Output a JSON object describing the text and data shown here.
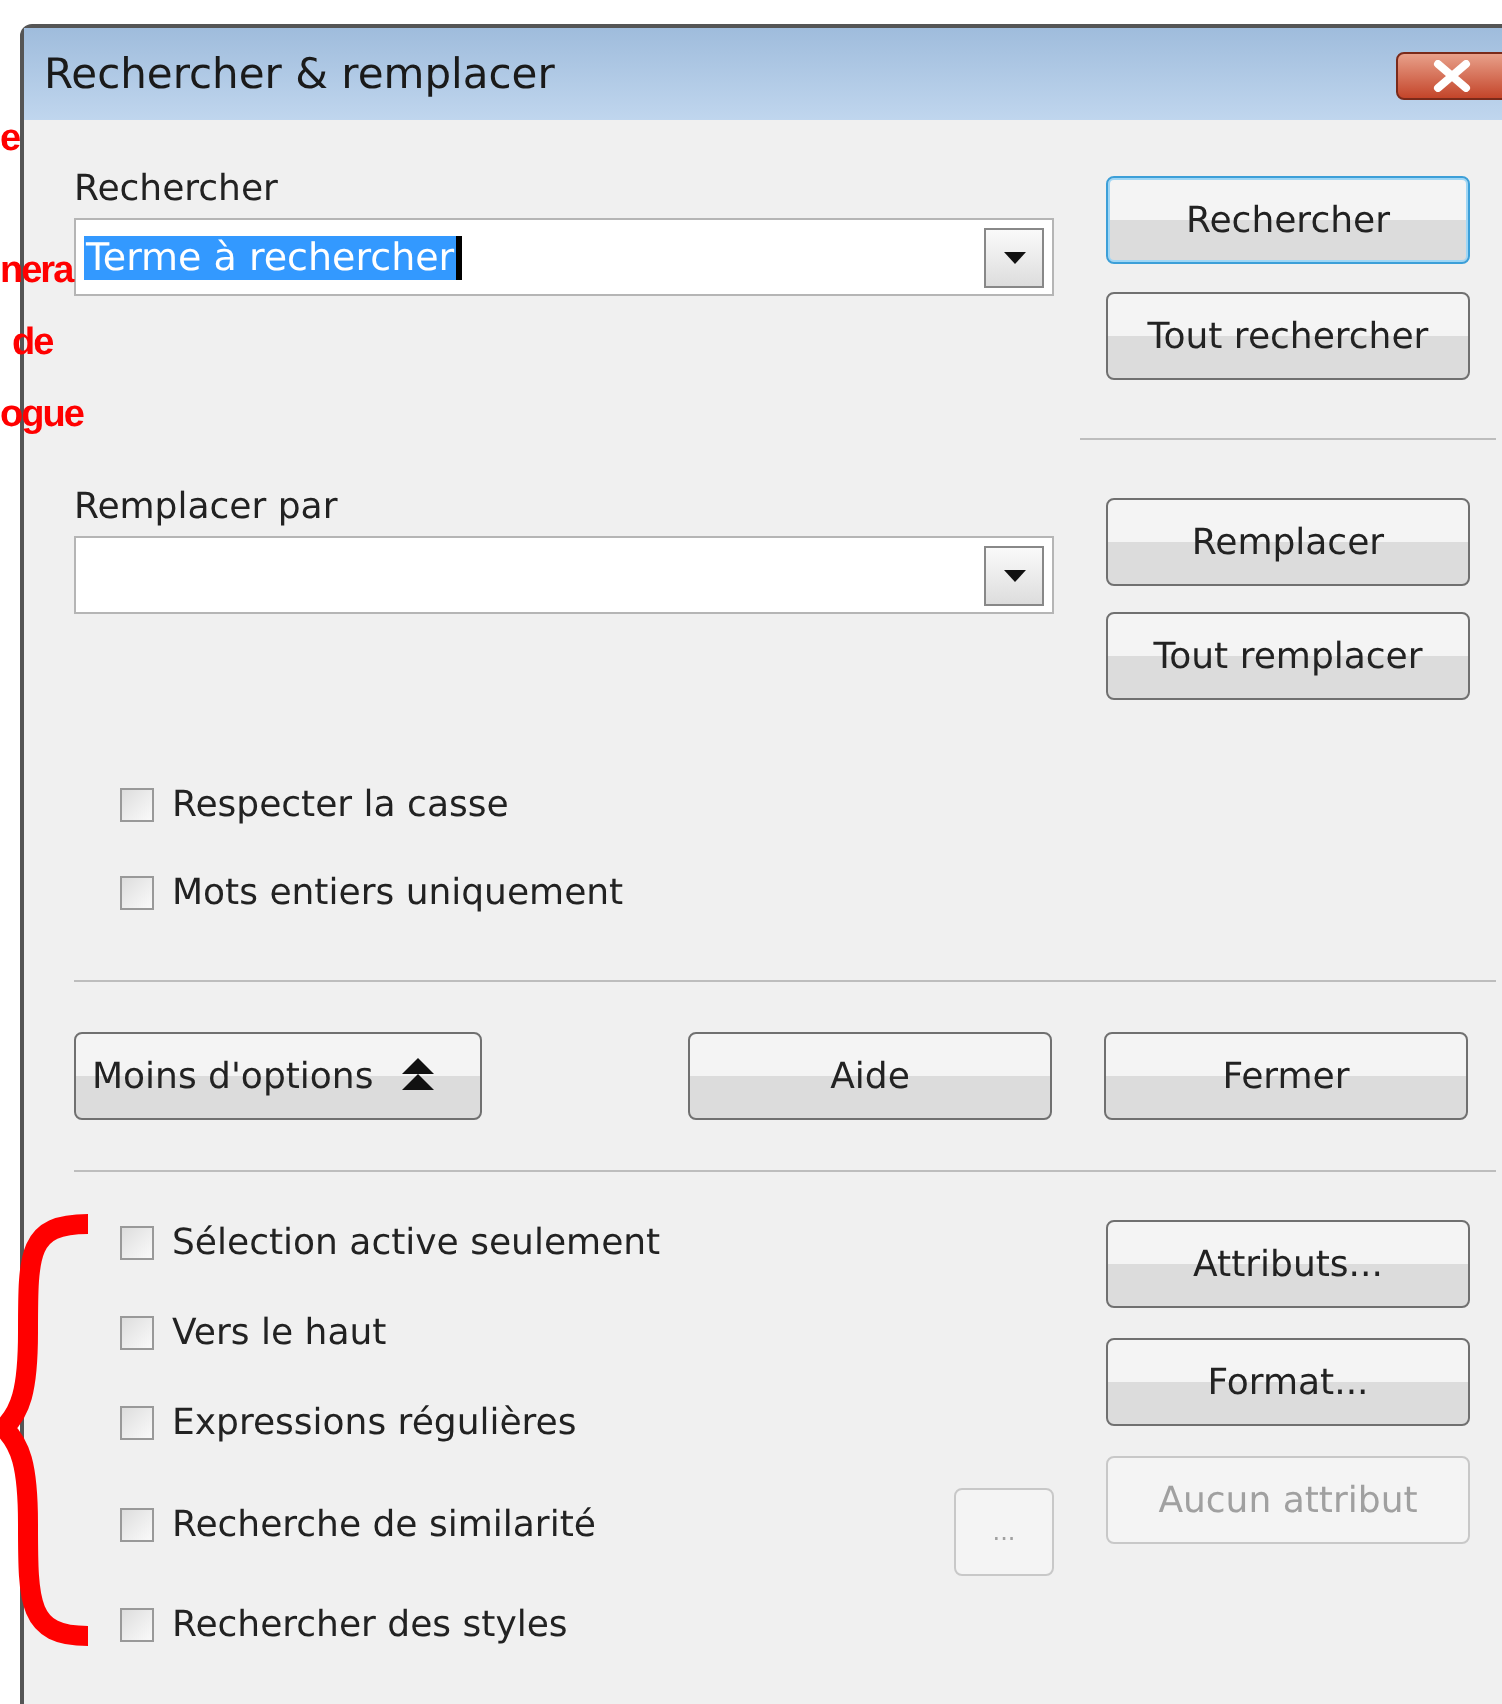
{
  "annotations": [
    "e",
    "nera",
    "de",
    "ogue"
  ],
  "window": {
    "title": "Rechercher & remplacer"
  },
  "search": {
    "label": "Rechercher",
    "value": "Terme à rechercher",
    "value_selected": true
  },
  "search_buttons": [
    {
      "label": "Rechercher",
      "focused": true,
      "disabled": false
    },
    {
      "label": "Tout rechercher",
      "focused": false,
      "disabled": false
    }
  ],
  "replace": {
    "label": "Remplacer par"
  },
  "replace_buttons": [
    {
      "label": "Remplacer",
      "focused": false,
      "disabled": false
    },
    {
      "label": "Tout remplacer",
      "focused": false,
      "disabled": false
    }
  ],
  "options": [
    {
      "label": "Respecter la casse",
      "checked": false
    },
    {
      "label": "Mots entiers uniquement",
      "checked": false
    }
  ],
  "more_options_button": {
    "label": "Moins d'options",
    "expanded": true
  },
  "footer_buttons": [
    {
      "label": "Aide",
      "focused": false,
      "disabled": false
    },
    {
      "label": "Fermer",
      "focused": false,
      "disabled": false
    }
  ],
  "extra_options": [
    {
      "label": "Sélection active seulement",
      "checked": false
    },
    {
      "label": "Vers le haut",
      "checked": false
    },
    {
      "label": "Expressions régulières",
      "checked": false
    },
    {
      "label": "Recherche de similarité",
      "checked": false
    },
    {
      "label": "Rechercher des styles",
      "checked": false
    }
  ],
  "similarity_button": {
    "label": "...",
    "focused": false,
    "disabled": true
  },
  "attribute_buttons": [
    {
      "label": "Attributs...",
      "focused": false,
      "disabled": false
    },
    {
      "label": "Format...",
      "focused": false,
      "disabled": false
    },
    {
      "label": "Aucun attribut",
      "focused": false,
      "disabled": true
    }
  ]
}
